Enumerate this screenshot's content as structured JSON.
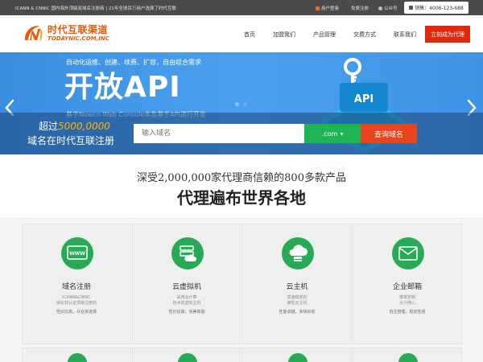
{
  "topbar": {
    "notice": "ICANN & CNNIC 国内海外顶级双域名注册商 | 21年全球百万用户选择了时代互联",
    "login": "用户登录",
    "register": "免费注册",
    "wechat": "公众号",
    "hotline": "销售：4006-123-688"
  },
  "header": {
    "logo_cn": "时代互联渠道",
    "logo_en": "TODAYNIC.COM,INC",
    "nav": [
      "首页",
      "加盟我们",
      "产品管理",
      "交费方式",
      "联系我们"
    ],
    "cta": "立刻成为代理"
  },
  "banner": {
    "sub": "自动化运维、创建、续费、扩容，自由组合需求",
    "big": "开放API",
    "desc": "基于Nowcn Web Console本身基于API进行开发",
    "api_label": "API"
  },
  "search": {
    "line1_prefix": "超过",
    "line1_highlight": "5000,0000",
    "line2": "域名在时代互联注册",
    "placeholder": "输入域名",
    "tld": ".com",
    "button": "查询域名"
  },
  "section": {
    "sub": "深受2,000,000家代理商信赖的800多款产品",
    "title": "代理遍布世界各地"
  },
  "cards": [
    {
      "title": "域名注册",
      "desc1": "ICANN&CNNIC",
      "desc2": "域名双认证顶级注册商",
      "tag": "性价比高，众业多选择",
      "icon": "www-icon"
    },
    {
      "title": "云虚拟机",
      "desc1": "采用云计算",
      "desc2": "技术的虚拟主机",
      "tag": "性价比高，完美体验",
      "icon": "cloud-server-icon"
    },
    {
      "title": "云主机",
      "desc1": "高速稳定的",
      "desc2": "弹性云主机",
      "tag": "性能卓越，多快好省",
      "icon": "cloud-host-icon"
    },
    {
      "title": "企业邮箱",
      "desc1": "按需定制",
      "desc2": "大小随心",
      "tag": "自主管理，稳定性强",
      "icon": "mail-icon"
    }
  ],
  "colors": {
    "brand_orange": "#e55b0a",
    "cta_red": "#e0290e",
    "banner_blue": "#4aa0ee",
    "green": "#27a956",
    "search_btn": "#e8451e",
    "tld_green": "#1fb454"
  }
}
